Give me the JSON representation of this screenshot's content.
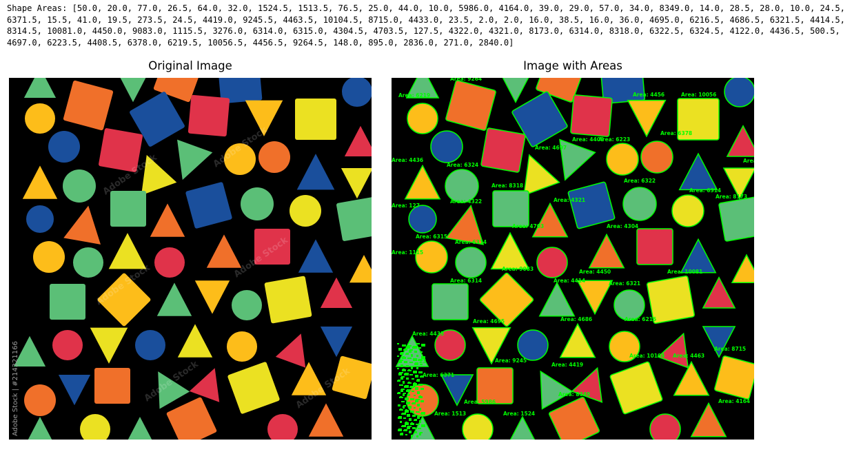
{
  "output": {
    "text": "Shape Areas: [50.0, 20.0, 77.0, 26.5, 64.0, 32.0, 1524.5, 1513.5, 76.5, 25.0, 44.0, 10.0, 5986.0, 4164.0, 39.0, 29.0, 57.0, 34.0, 8349.0, 14.0, 28.5, 28.0, 10.0, 24.5, 6371.5, 15.5, 41.0, 19.5, 273.5, 24.5, 4419.0, 9245.5, 4463.5, 10104.5, 8715.0, 4433.0, 23.5, 2.0, 2.0, 16.0, 38.5, 16.0, 36.0, 4695.0, 6216.5, 4686.5, 6321.5, 4414.5, 8314.5, 10081.0, 4450.0, 9083.0, 1115.5, 3276.0, 6314.0, 6315.0, 4304.5, 4703.5, 127.5, 4322.0, 4321.0, 8173.0, 6314.0, 8318.0, 6322.5, 6324.5, 4122.0, 4436.5, 500.5, 4697.0, 6223.5, 4408.5, 6378.0, 6219.5, 10056.5, 4456.5, 9264.5, 148.0, 895.0, 2836.0, 271.0, 2840.0]"
  },
  "figure": {
    "left_title": "Original Image",
    "right_title": "Image with Areas",
    "watermark_side": "Adobe Stock | #214321166",
    "watermark_faint": "Adobe Stock"
  },
  "area_labels": [
    {
      "text": "Area: 9264"
    },
    {
      "text": "Area: 6219"
    },
    {
      "text": "Area: 4456"
    },
    {
      "text": "Area: 10056"
    },
    {
      "text": "Area: 6378"
    },
    {
      "text": "Area: 4697"
    },
    {
      "text": "Area: 4408"
    },
    {
      "text": "Area: 6223"
    },
    {
      "text": "Area: 4436"
    },
    {
      "text": "Area: 6324"
    },
    {
      "text": "Area: 412"
    },
    {
      "text": "Area: 6322"
    },
    {
      "text": "Area: 6314"
    },
    {
      "text": "Area: 8318"
    },
    {
      "text": "Area: 4321"
    },
    {
      "text": "Area: 8173"
    },
    {
      "text": "Area: 127"
    },
    {
      "text": "Area: 4322"
    },
    {
      "text": "Area: 4703"
    },
    {
      "text": "Area: 4304"
    },
    {
      "text": "Area: 6315"
    },
    {
      "text": "Area: 6314"
    },
    {
      "text": "Area: 1115"
    },
    {
      "text": "Area: 9083"
    },
    {
      "text": "Area: 4450"
    },
    {
      "text": "Area: 10081"
    },
    {
      "text": "Area: 6314"
    },
    {
      "text": "Area: 4414"
    },
    {
      "text": "Area: 6321"
    },
    {
      "text": "Area: 4695"
    },
    {
      "text": "Area: 4686"
    },
    {
      "text": "Area: 6216"
    },
    {
      "text": "Area: 4433"
    },
    {
      "text": "Area: 10104"
    },
    {
      "text": "Area: 4463"
    },
    {
      "text": "Area: 8715"
    },
    {
      "text": "Area: 9245"
    },
    {
      "text": "Area: 4419"
    },
    {
      "text": "Area: 6371"
    },
    {
      "text": "Area: 8349"
    },
    {
      "text": "Area: 5986"
    },
    {
      "text": "Area: 1513"
    },
    {
      "text": "Area: 1524"
    },
    {
      "text": "Area: 4164"
    },
    {
      "text": "23"
    }
  ],
  "colors": {
    "background": "#000000",
    "red": "#e0334a",
    "orange": "#f0702a",
    "yellow": "#ebe122",
    "gold": "#fdbd1a",
    "green": "#5bbf77",
    "blue": "#1a4f9c",
    "contour": "#00ff00"
  }
}
